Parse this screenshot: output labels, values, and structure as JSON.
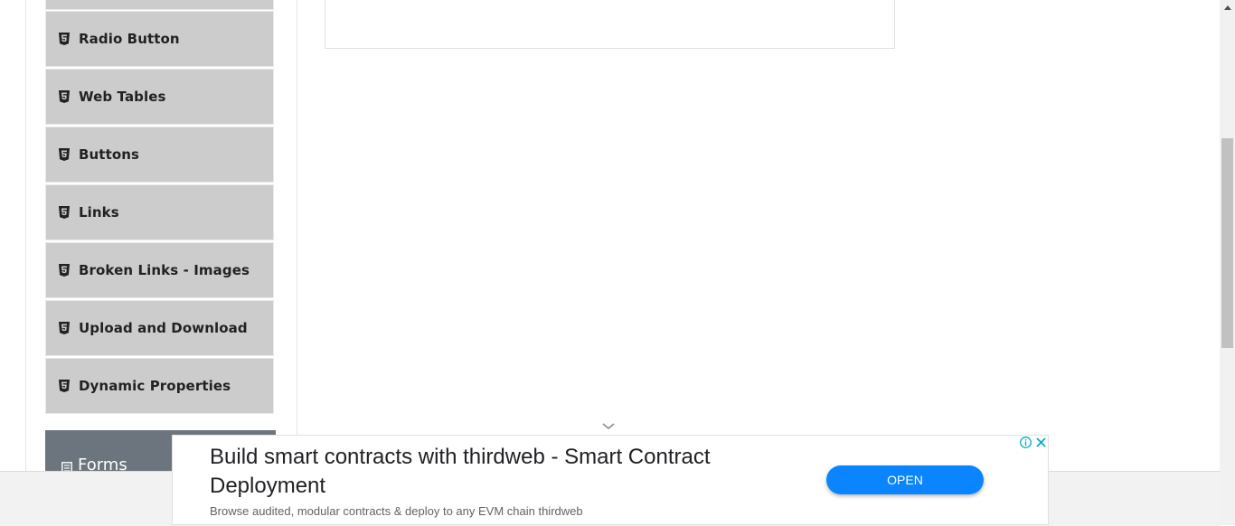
{
  "sidebar": {
    "items": [
      {
        "label": "Radio Button",
        "icon": "html5-icon"
      },
      {
        "label": "Web Tables",
        "icon": "html5-icon"
      },
      {
        "label": "Buttons",
        "icon": "html5-icon"
      },
      {
        "label": "Links",
        "icon": "html5-icon"
      },
      {
        "label": "Broken Links - Images",
        "icon": "html5-icon"
      },
      {
        "label": "Upload and Download",
        "icon": "html5-icon"
      },
      {
        "label": "Dynamic Properties",
        "icon": "html5-icon"
      }
    ],
    "next_group": {
      "label": "Forms",
      "icon": "document-icon"
    }
  },
  "ad": {
    "title": "Build smart contracts with thirdweb - Smart Contract Deployment",
    "description": "Browse audited, modular contracts & deploy to any EVM chain thirdweb",
    "cta_label": "OPEN"
  },
  "colors": {
    "menu_item_bg": "#cccccc",
    "group_header_bg": "#6c757d",
    "ad_button": "#0a84ff"
  }
}
